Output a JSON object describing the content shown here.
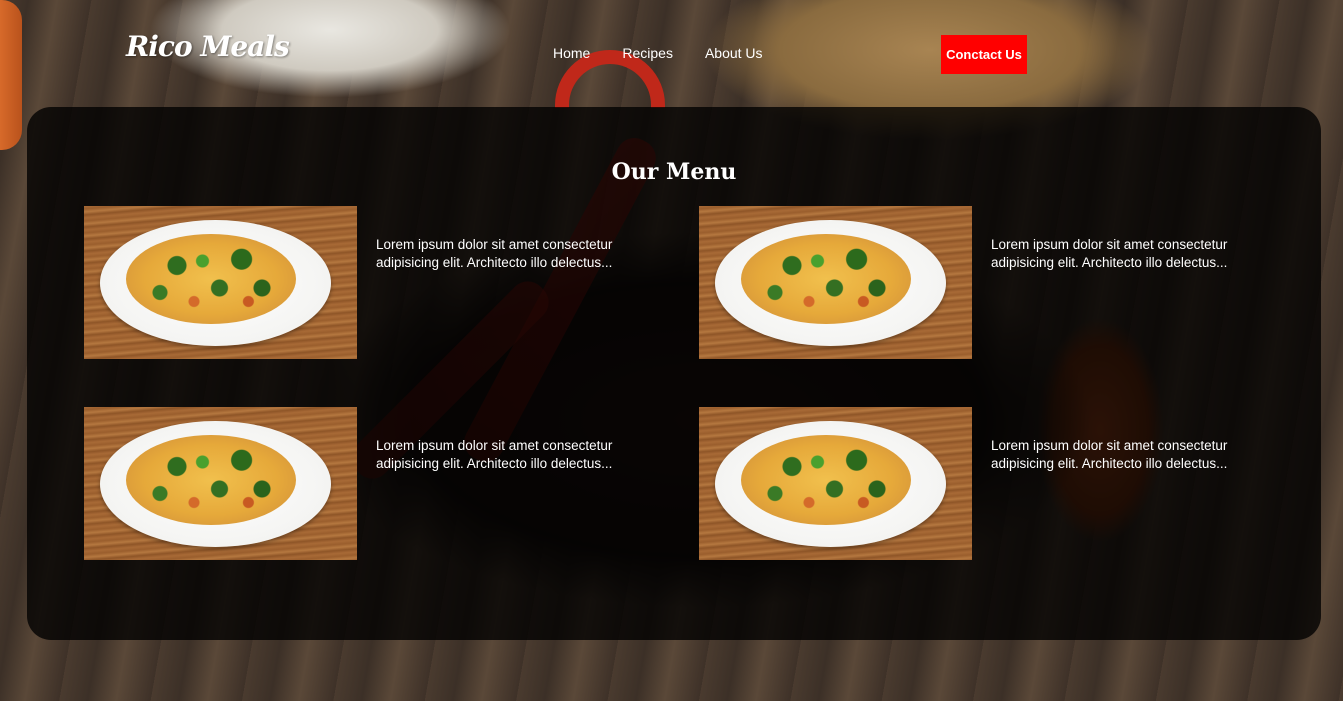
{
  "brand": {
    "name": "Rico Meals"
  },
  "nav": {
    "links": [
      {
        "label": "Home"
      },
      {
        "label": "Recipes"
      },
      {
        "label": "About Us"
      }
    ],
    "cta_label": "Conctact Us",
    "cta_color": "#ff0000"
  },
  "menu": {
    "title": "Our Menu",
    "items": [
      {
        "description": "Lorem ipsum dolor sit amet consectetur adipisicing elit. Architecto illo delectus..."
      },
      {
        "description": "Lorem ipsum dolor sit amet consectetur adipisicing elit. Architecto illo delectus..."
      },
      {
        "description": "Lorem ipsum dolor sit amet consectetur adipisicing elit. Architecto illo delectus..."
      },
      {
        "description": "Lorem ipsum dolor sit amet consectetur adipisicing elit. Architecto illo delectus..."
      }
    ]
  },
  "colors": {
    "panel_overlay": "rgba(0,0,0,0.78)",
    "text": "#ffffff"
  }
}
